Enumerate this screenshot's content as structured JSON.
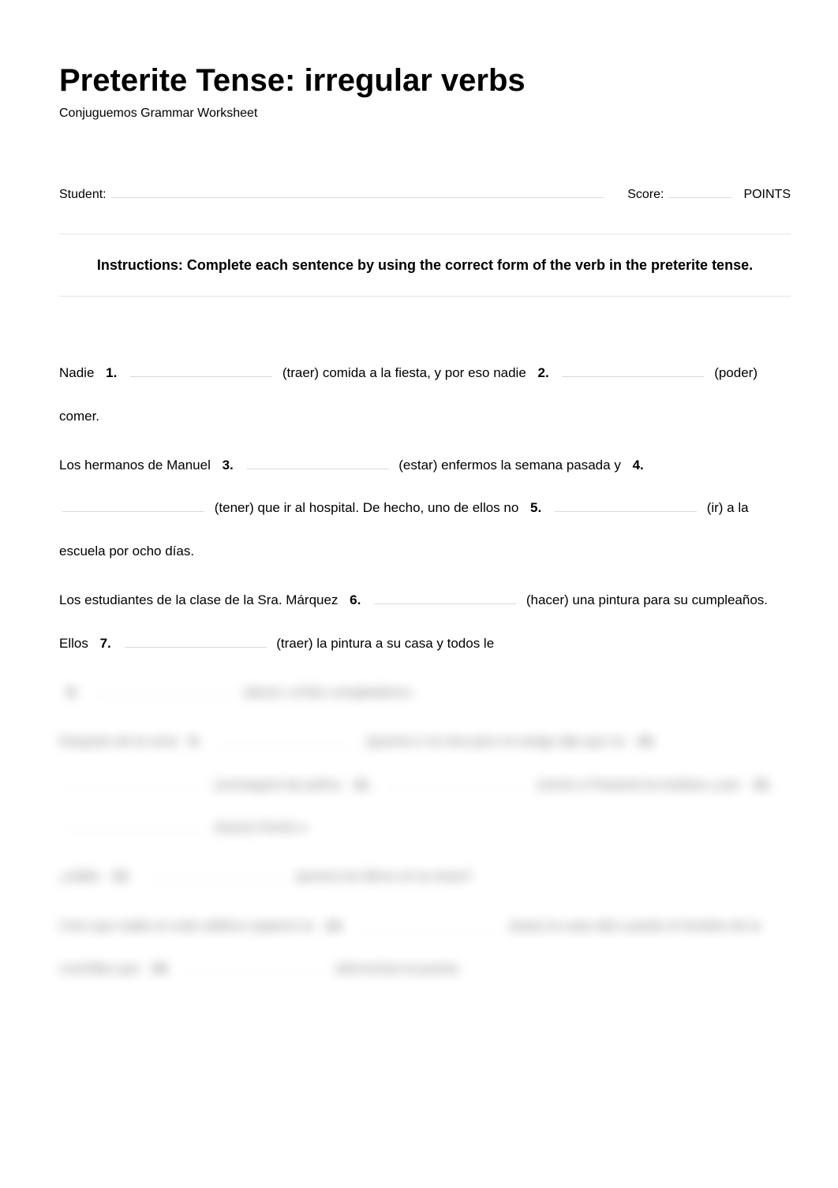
{
  "title": "Preterite Tense: irregular verbs",
  "subtitle": "Conjuguemos Grammar Worksheet",
  "meta": {
    "student_label": "Student:",
    "score_label": "Score:",
    "points_label": "POINTS"
  },
  "instructions": "Instructions: Complete each sentence by using the correct form of the verb in the preterite tense.",
  "sentences": {
    "s1_part1": "Nadie",
    "n1": "1.",
    "s1_hint1": "(traer) comida a la fiesta, y por eso nadie",
    "n2": "2.",
    "s1_hint2": "(poder) comer.",
    "s2_part1": "Los hermanos de Manuel",
    "n3": "3.",
    "s2_hint1": "(estar) enfermos la semana pasada y",
    "n4": "4.",
    "s2_hint2": "(tener) que ir al hospital. De hecho, uno de ellos no",
    "n5": "5.",
    "s2_hint3": "(ir) a la escuela por ocho días.",
    "s3_part1": "Los estudiantes de la clase de la Sra. Márquez",
    "n6": "6.",
    "s3_hint1": "(hacer) una pintura para su",
    "s3_part2": "cumpleaños. Ellos",
    "n7": "7.",
    "s3_hint2": "(traer) la pintura a su casa y todos le",
    "n8": "8.",
    "s3_hint3": "(decir) «¡Feliz cumpleaños!».",
    "s4_part1": "Después de la cena",
    "n9": "9.",
    "s4_hint1": "(querer) ir al cine pero mi amigo dijo que no",
    "n10": "10.",
    "s4_hint2": "(conseguir) las pelícu",
    "n11": "11.",
    "s4_hint3": "(venir) a Panamá",
    "s4_part2": "los boletos y por",
    "n12": "12.",
    "s4_hint4": "(hacer) frente a",
    "s5_part1": "¿Aditis",
    "n13": "13.",
    "s5_hint1": "(poner) los libros en la mesa?",
    "s6_part1": "Creo que nadie en este edificio supieron la",
    "n14": "14.",
    "s6_hint1": "(traer) la casa ella cuando el",
    "s6_part2": "hombre de la cocinillas que",
    "n15": "15.",
    "s6_hint2": "(derrochar) la puerta."
  }
}
